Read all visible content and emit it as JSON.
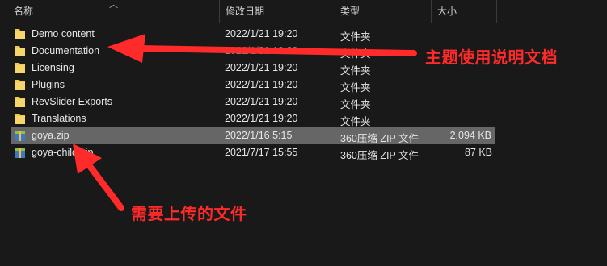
{
  "columns": {
    "name": "名称",
    "modified": "修改日期",
    "type": "类型",
    "size": "大小"
  },
  "rows": [
    {
      "name": "Demo content",
      "date": "2022/1/21 19:20",
      "type": "文件夹",
      "size": "",
      "icon": "folder-icon"
    },
    {
      "name": "Documentation",
      "date": "2022/1/21 19:20",
      "type": "文件夹",
      "size": "",
      "icon": "folder-icon"
    },
    {
      "name": "Licensing",
      "date": "2022/1/21 19:20",
      "type": "文件夹",
      "size": "",
      "icon": "folder-icon"
    },
    {
      "name": "Plugins",
      "date": "2022/1/21 19:20",
      "type": "文件夹",
      "size": "",
      "icon": "folder-icon"
    },
    {
      "name": "RevSlider Exports",
      "date": "2022/1/21 19:20",
      "type": "文件夹",
      "size": "",
      "icon": "folder-icon"
    },
    {
      "name": "Translations",
      "date": "2022/1/21 19:20",
      "type": "文件夹",
      "size": "",
      "icon": "folder-icon"
    },
    {
      "name": "goya.zip",
      "date": "2022/1/16 5:15",
      "type": "360压缩 ZIP 文件",
      "size": "2,094 KB",
      "icon": "zip-archive-icon",
      "selected": true
    },
    {
      "name": "goya-child.zip",
      "date": "2021/7/17 15:55",
      "type": "360压缩 ZIP 文件",
      "size": "87 KB",
      "icon": "zip-archive-icon"
    }
  ],
  "annotations": {
    "documentation_note": "主题使用说明文档",
    "upload_note": "需要上传的文件",
    "color": "#ff2a2a"
  },
  "colors": {
    "background": "#191919",
    "selected_row": "#666666",
    "folder": "#f2c94c"
  }
}
